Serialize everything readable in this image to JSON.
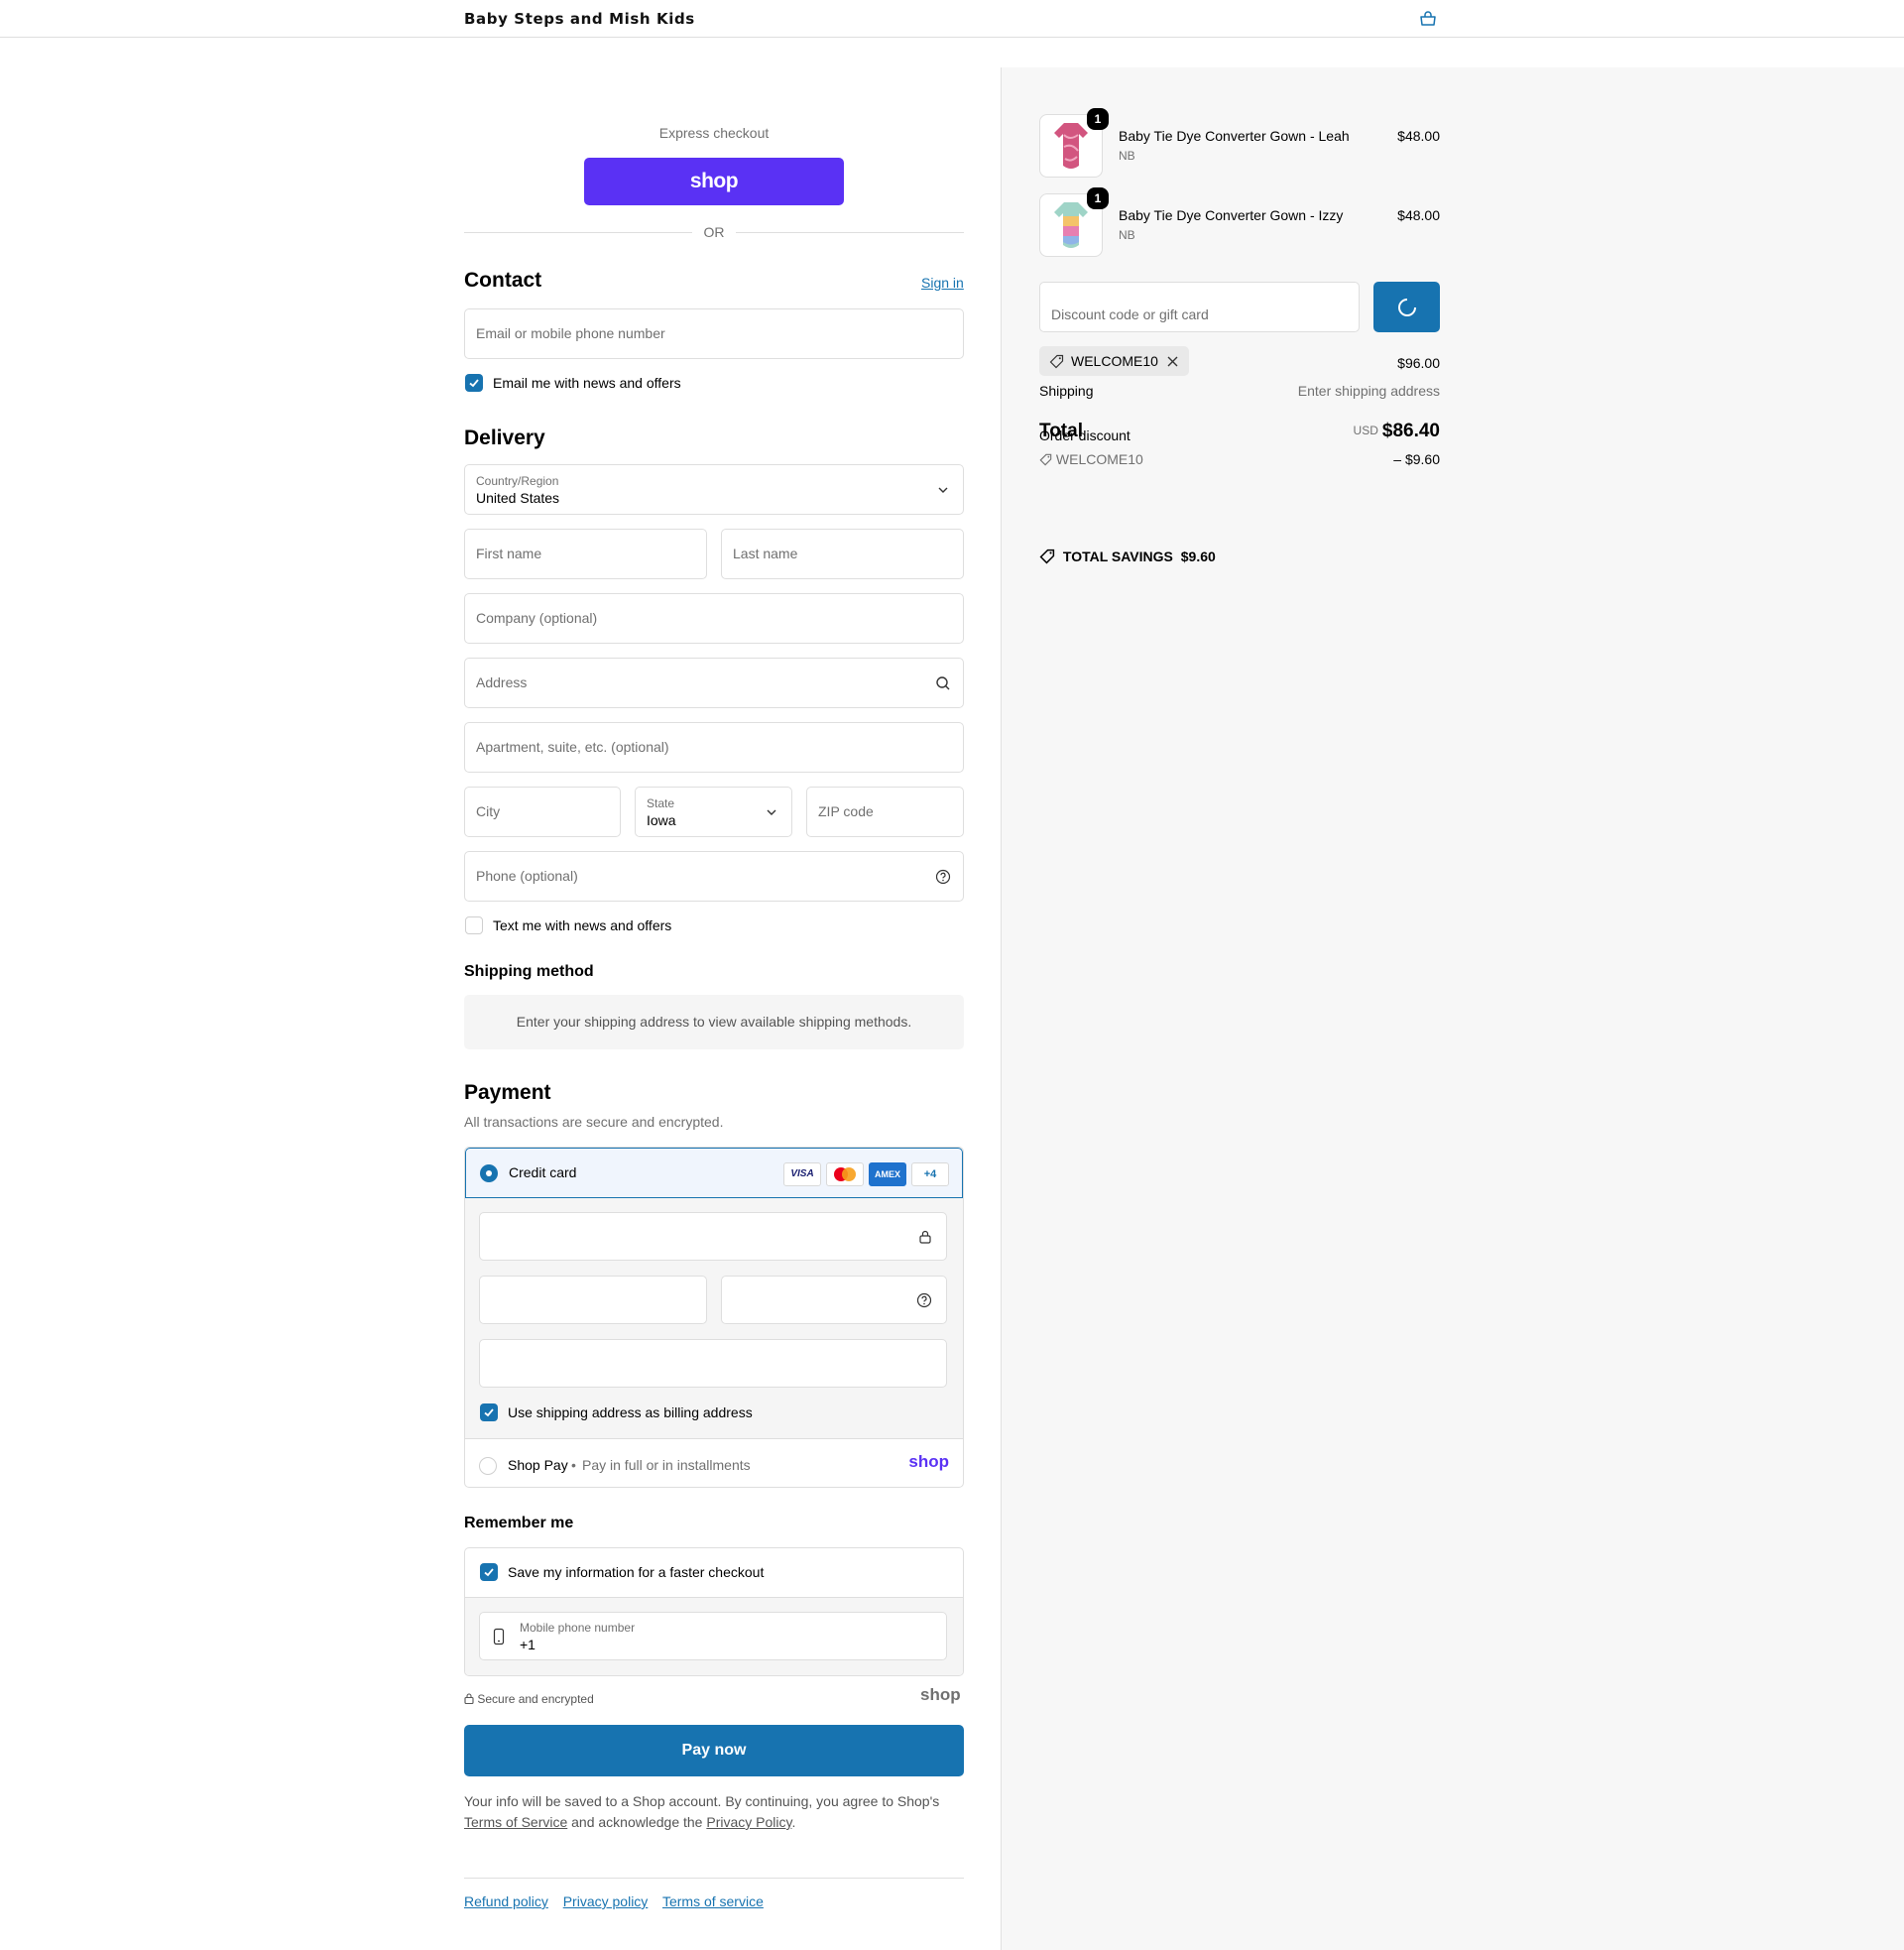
{
  "header": {
    "store_name": "Baby Steps and Mish Kids",
    "cart_icon": "bag-icon"
  },
  "express": {
    "label": "Express checkout",
    "shop_button": "shop",
    "or": "OR"
  },
  "contact": {
    "title": "Contact",
    "sign_in": "Sign in",
    "email_placeholder": "Email or mobile phone number",
    "email_news_label": "Email me with news and offers",
    "email_news_checked": true
  },
  "delivery": {
    "title": "Delivery",
    "country_label": "Country/Region",
    "country_value": "United States",
    "first_name_placeholder": "First name",
    "last_name_placeholder": "Last name",
    "company_placeholder": "Company (optional)",
    "address_placeholder": "Address",
    "apartment_placeholder": "Apartment, suite, etc. (optional)",
    "city_placeholder": "City",
    "state_label": "State",
    "state_value": "Iowa",
    "zip_placeholder": "ZIP code",
    "phone_placeholder": "Phone (optional)",
    "text_news_label": "Text me with news and offers",
    "text_news_checked": false
  },
  "shipping_method": {
    "title": "Shipping method",
    "message": "Enter your shipping address to view available shipping methods."
  },
  "payment": {
    "title": "Payment",
    "subtitle": "All transactions are secure and encrypted.",
    "credit_card_label": "Credit card",
    "card_logos": [
      "VISA",
      "mastercard",
      "AMEX",
      "+4"
    ],
    "billing_label": "Use shipping address as billing address",
    "shop_pay_label": "Shop Pay",
    "shop_pay_sub": "Pay in full or in installments",
    "shop_pay_logo": "shop"
  },
  "remember": {
    "title": "Remember me",
    "save_label": "Save my information for a faster checkout",
    "phone_label": "Mobile phone number",
    "phone_value": "+1",
    "secure_label": "Secure and encrypted",
    "shop_logo": "shop"
  },
  "pay_now": "Pay now",
  "legal": {
    "line1": "Your info will be saved to a Shop account. By continuing, you agree to Shop's",
    "terms": "Terms of Service",
    "and": "and acknowledge the",
    "privacy": "Privacy Policy",
    "end": "."
  },
  "footer": {
    "refund": "Refund policy",
    "privacy": "Privacy policy",
    "terms": "Terms of service"
  },
  "summary": {
    "items": [
      {
        "name": "Baby Tie Dye Converter Gown - Leah",
        "variant": "NB",
        "price": "$48.00",
        "qty": "1"
      },
      {
        "name": "Baby Tie Dye Converter Gown - Izzy",
        "variant": "NB",
        "price": "$48.00",
        "qty": "1"
      }
    ],
    "discount_placeholder": "Discount code or gift card",
    "applied_code": "WELCOME10",
    "subtotal_value": "$96.00",
    "shipping_label": "Shipping",
    "shipping_value": "Enter shipping address",
    "total_label": "Total",
    "order_discount_label": "Order discount",
    "total_currency": "USD",
    "total_value": "$86.40",
    "discount_code": "WELCOME10",
    "discount_value": "– $9.60",
    "savings_label": "TOTAL SAVINGS",
    "savings_value": "$9.60"
  },
  "colors": {
    "accent": "#1773b0",
    "shop_purple": "#5a31f4"
  }
}
